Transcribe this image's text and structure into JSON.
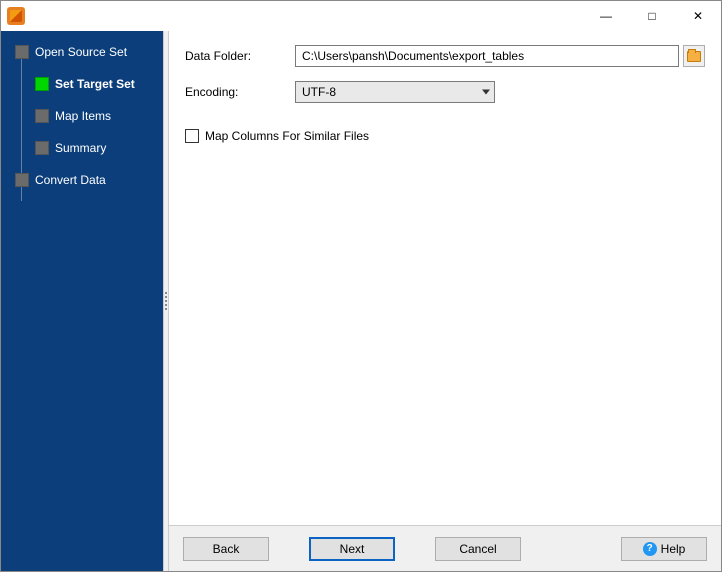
{
  "window": {
    "minimize": "—",
    "maximize": "□",
    "close": "✕"
  },
  "sidebar": {
    "items": [
      {
        "label": "Open Source Set",
        "level": 0,
        "active": false,
        "bold": false
      },
      {
        "label": "Set Target Set",
        "level": 1,
        "active": true,
        "bold": true
      },
      {
        "label": "Map Items",
        "level": 1,
        "active": false,
        "bold": false
      },
      {
        "label": "Summary",
        "level": 1,
        "active": false,
        "bold": false
      },
      {
        "label": "Convert Data",
        "level": 0,
        "active": false,
        "bold": false
      }
    ]
  },
  "form": {
    "data_folder_label": "Data Folder:",
    "data_folder_value": "C:\\Users\\pansh\\Documents\\export_tables",
    "encoding_label": "Encoding:",
    "encoding_value": "UTF-8",
    "map_columns_label": "Map Columns For Similar Files",
    "map_columns_checked": false
  },
  "buttons": {
    "back": "Back",
    "next": "Next",
    "cancel": "Cancel",
    "help": "Help"
  }
}
